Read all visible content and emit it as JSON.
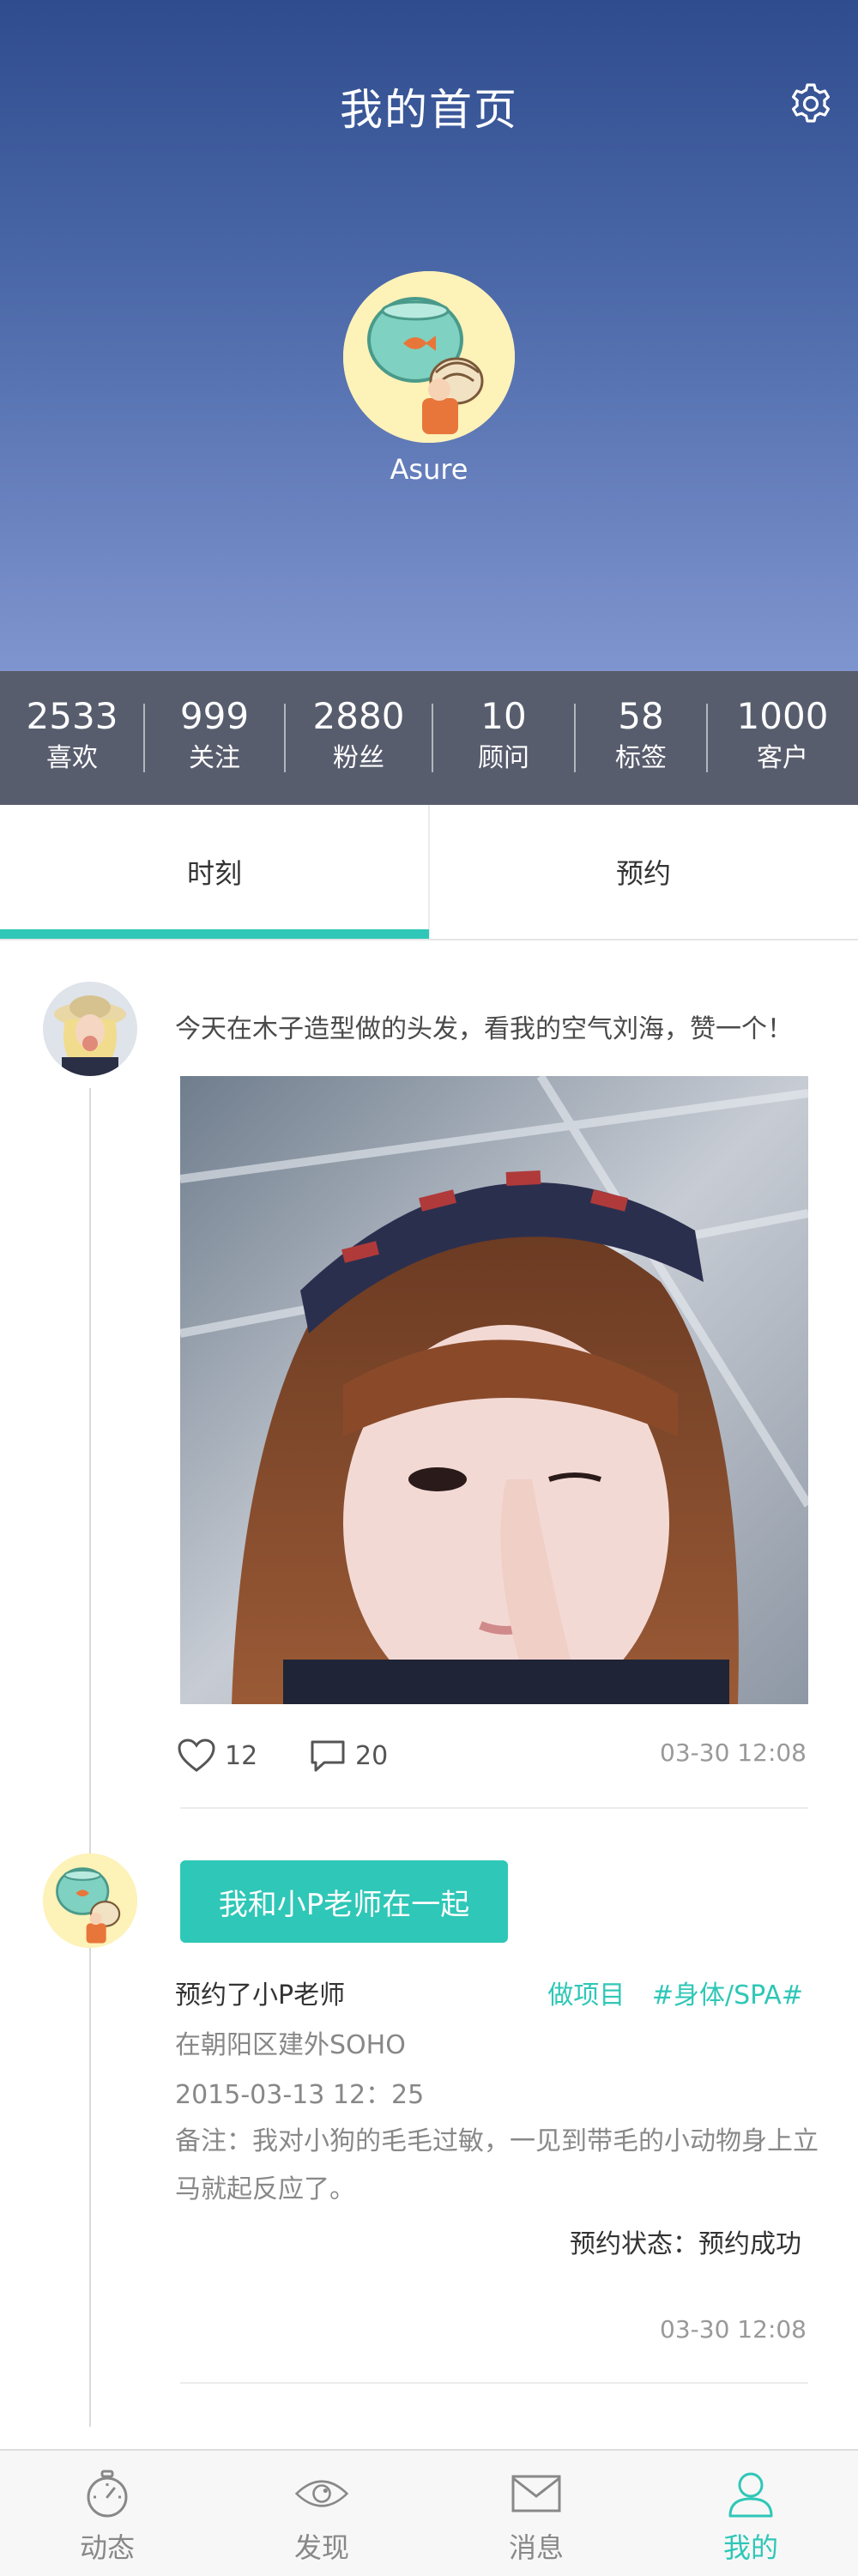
{
  "header": {
    "title": "我的首页",
    "settings_icon": "gear-icon",
    "username": "Asure"
  },
  "stats": [
    {
      "value": "2533",
      "label": "喜欢"
    },
    {
      "value": "999",
      "label": "关注"
    },
    {
      "value": "2880",
      "label": "粉丝"
    },
    {
      "value": "10",
      "label": "顾问"
    },
    {
      "value": "58",
      "label": "标签"
    },
    {
      "value": "1000",
      "label": "客户"
    }
  ],
  "tabs": [
    {
      "label": "时刻",
      "active": true
    },
    {
      "label": "预约",
      "active": false
    }
  ],
  "posts": [
    {
      "text": "今天在木子造型做的头发，看我的空气刘海，赞一个！",
      "likes": "12",
      "comments": "20",
      "time": "03-30 12:08"
    }
  ],
  "appointment": {
    "button_label": "我和小P老师在一起",
    "title": "预约了小P老师",
    "tags": [
      "做项目",
      "#身体/SPA#"
    ],
    "location": "在朝阳区建外SOHO",
    "datetime": "2015-03-13   12：25",
    "note": "备注：我对小狗的毛毛过敏，一见到带毛的小动物身上立马就起反应了。",
    "status": "预约状态：预约成功",
    "time": "03-30 12:08"
  },
  "nav": [
    {
      "label": "动态",
      "icon": "stopwatch-icon",
      "active": false
    },
    {
      "label": "发现",
      "icon": "eye-icon",
      "active": false
    },
    {
      "label": "消息",
      "icon": "envelope-icon",
      "active": false
    },
    {
      "label": "我的",
      "icon": "user-icon",
      "active": true
    }
  ],
  "colors": {
    "accent": "#2fc7b7",
    "header_top": "#2f4c8e",
    "header_bottom": "#7f95cf",
    "stats_bar": "#585d6e"
  }
}
